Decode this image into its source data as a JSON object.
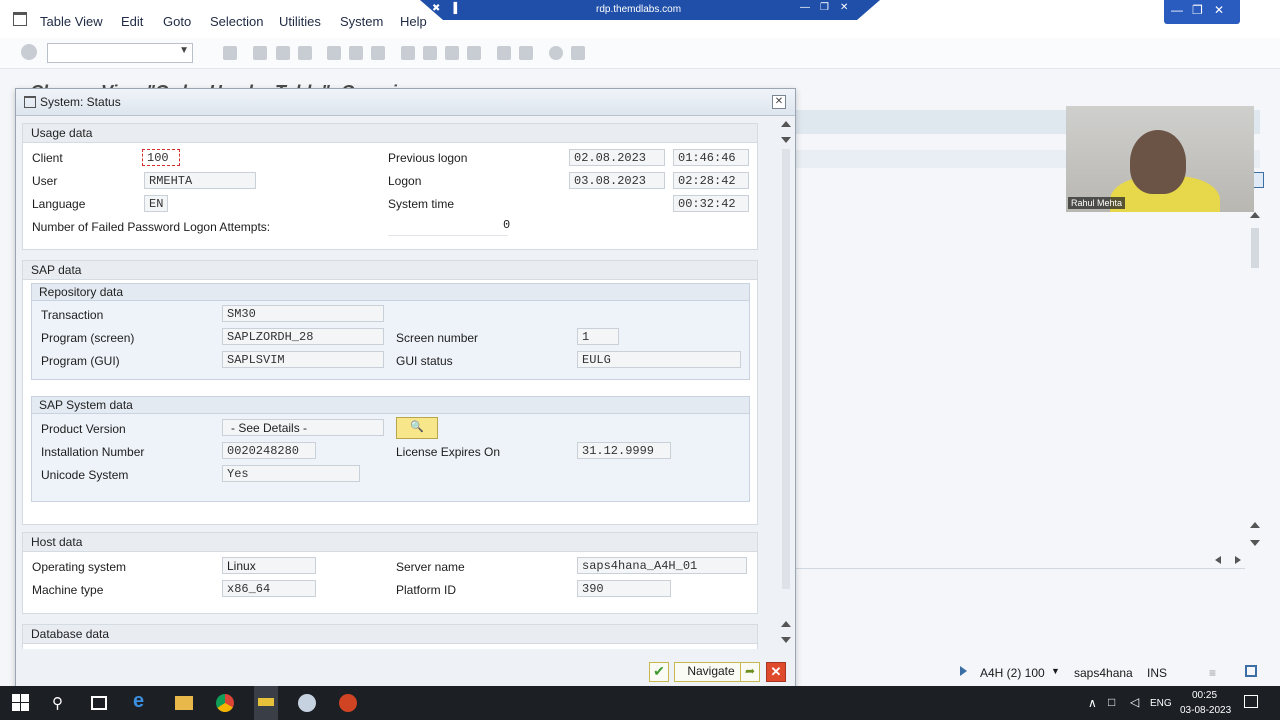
{
  "menu": {
    "items": [
      "Table View",
      "Edit",
      "Goto",
      "Selection",
      "Utilities",
      "System",
      "Help"
    ]
  },
  "rdp": {
    "host": "rdp.themdlabs.com"
  },
  "background": {
    "title": "Change View \"Order Header Table\": Overview"
  },
  "video": {
    "name": "Rahul Mehta"
  },
  "dialog": {
    "title": "System: Status",
    "usage": {
      "heading": "Usage data",
      "client_label": "Client",
      "client": "100",
      "user_label": "User",
      "user": "RMEHTA",
      "language_label": "Language",
      "language": "EN",
      "failed_label": "Number of Failed Password Logon Attempts:",
      "failed": "0",
      "prev_logon_label": "Previous logon",
      "prev_logon_date": "02.08.2023",
      "prev_logon_time": "01:46:46",
      "logon_label": "Logon",
      "logon_date": "03.08.2023",
      "logon_time": "02:28:42",
      "system_time_label": "System time",
      "system_time": "00:32:42"
    },
    "sap": {
      "heading": "SAP data",
      "repo": {
        "heading": "Repository data",
        "transaction_label": "Transaction",
        "transaction": "SM30",
        "program_screen_label": "Program (screen)",
        "program_screen": "SAPLZORDH_28",
        "program_gui_label": "Program (GUI)",
        "program_gui": "SAPLSVIM",
        "screen_number_label": "Screen number",
        "screen_number": "1",
        "gui_status_label": "GUI status",
        "gui_status": "EULG"
      },
      "system": {
        "heading": "SAP System data",
        "product_version_label": "Product Version",
        "product_version": "- See Details -",
        "installation_label": "Installation Number",
        "installation": "0020248280",
        "unicode_label": "Unicode System",
        "unicode": "Yes",
        "license_label": "License Expires On",
        "license": "31.12.9999"
      }
    },
    "host": {
      "heading": "Host data",
      "os_label": "Operating system",
      "os": "Linux",
      "machine_label": "Machine type",
      "machine": "x86_64",
      "server_label": "Server name",
      "server": "saps4hana_A4H_01",
      "platform_label": "Platform ID",
      "platform": "390"
    },
    "database": {
      "heading": "Database data"
    },
    "footer": {
      "navigate_label": "Navigate"
    }
  },
  "status": {
    "system": "A4H (2) 100",
    "server": "saps4hana",
    "mode": "INS"
  },
  "taskbar": {
    "lang": "ENG",
    "time": "00:25",
    "date": "03-08-2023"
  }
}
